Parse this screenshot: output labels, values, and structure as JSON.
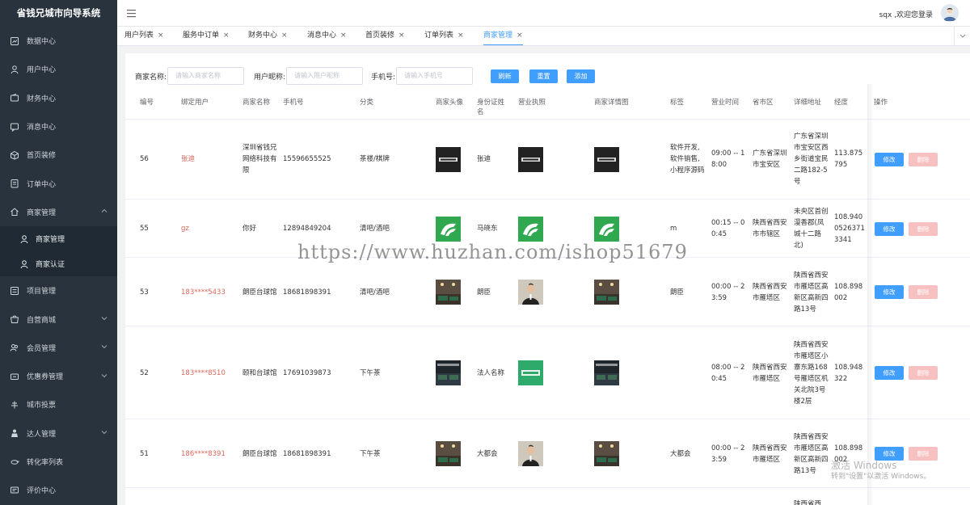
{
  "app_title": "省钱兄城市向导系统",
  "header": {
    "welcome": "sqx ,欢迎您登录"
  },
  "sidebar": {
    "items": [
      {
        "label": "数据中心",
        "icon": "dashboard-icon"
      },
      {
        "label": "用户中心",
        "icon": "user-icon"
      },
      {
        "label": "财务中心",
        "icon": "wallet-icon"
      },
      {
        "label": "消息中心",
        "icon": "message-icon"
      },
      {
        "label": "首页装修",
        "icon": "cube-icon"
      },
      {
        "label": "订单中心",
        "icon": "order-icon"
      },
      {
        "label": "商家管理",
        "icon": "home-icon"
      },
      {
        "label": "项目管理",
        "icon": "project-icon"
      },
      {
        "label": "自营商城",
        "icon": "shop-icon"
      },
      {
        "label": "会员管理",
        "icon": "member-icon"
      },
      {
        "label": "优惠券管理",
        "icon": "coupon-icon"
      },
      {
        "label": "城市投票",
        "icon": "vote-icon"
      },
      {
        "label": "达人管理",
        "icon": "expert-icon"
      },
      {
        "label": "转化率列表",
        "icon": "conversion-icon"
      },
      {
        "label": "评价中心",
        "icon": "review-icon"
      }
    ],
    "sub_items": [
      {
        "label": "商家管理"
      },
      {
        "label": "商家认证"
      }
    ]
  },
  "tabs": [
    {
      "label": "用户列表"
    },
    {
      "label": "服务中订单"
    },
    {
      "label": "财务中心"
    },
    {
      "label": "消息中心"
    },
    {
      "label": "首页装修"
    },
    {
      "label": "订单列表"
    },
    {
      "label": "商家管理"
    }
  ],
  "filters": {
    "merchant_name_label": "商家名称:",
    "merchant_name_placeholder": "请输入商家名称",
    "nickname_label": "用户昵称:",
    "nickname_placeholder": "请输入用户昵称",
    "phone_label": "手机号:",
    "phone_placeholder": "请输入手机号",
    "refresh": "刷新",
    "reset": "重置",
    "add": "添加"
  },
  "table": {
    "columns": [
      "编号",
      "绑定用户",
      "商家名称",
      "手机号",
      "分类",
      "商家头像",
      "身份证姓名",
      "营业执照",
      "商家详情图",
      "标签",
      "营业时间",
      "省市区",
      "详细地址",
      "经度",
      "操作"
    ],
    "edit_label": "修改",
    "delete_label": "删除",
    "rows": [
      {
        "id": "56",
        "user": "张迪",
        "name": "深圳省钱兄网络科技有限",
        "phone": "15596655525",
        "category": "茶楼/棋牌",
        "idname": "张迪",
        "tag": "软件开发,软件销售,小程序源码",
        "hours": "09:00 -- 18:00",
        "region": "广东省深圳市宝安区",
        "address": "广东省深圳市宝安区西乡街道宝民二路182-5号",
        "lng": "113.875795",
        "thumb": "brand"
      },
      {
        "id": "55",
        "user": "gz",
        "name": "你好",
        "phone": "12894849204",
        "category": "清吧/酒吧",
        "idname": "马晓东",
        "tag": "m",
        "hours": "00:15 -- 00:45",
        "region": "陕西省西安市市辖区",
        "address": "未央区首创漫香郡(凤城十二路北)",
        "lng": "108.94005263713341",
        "thumb": "green"
      },
      {
        "id": "53",
        "user": "183****5433",
        "name": "朗臣台球馆",
        "phone": "18681898391",
        "category": "清吧/酒吧",
        "idname": "朗臣",
        "tag": "朗臣",
        "hours": "00:00 -- 23:59",
        "region": "陕西省西安市雁塔区",
        "address": "陕西省西安市雁塔区高新区高新四路13号",
        "lng": "108.898002",
        "thumb": "photo"
      },
      {
        "id": "52",
        "user": "183****8510",
        "name": "颐和台球馆",
        "phone": "17691039873",
        "category": "下午茶",
        "idname": "法人名称",
        "tag": "",
        "hours": "08:00 -- 20:45",
        "region": "陕西省西安市雁塔区",
        "address": "陕西省西安市雁塔区小寨东路168号雁塔区机关北院3号楼2层",
        "lng": "108.948322",
        "thumb": "hall"
      },
      {
        "id": "51",
        "user": "186****8391",
        "name": "朗臣台球馆",
        "phone": "18681898391",
        "category": "下午茶",
        "idname": "大都会",
        "tag": "大都会",
        "hours": "00:00 -- 23:59",
        "region": "陕西省西安市雁塔区",
        "address": "陕西省西安市雁塔区高新区高新四路13号",
        "lng": "108.898002",
        "thumb": "photo"
      },
      {
        "id": "",
        "user": "",
        "name": "",
        "phone": "",
        "category": "",
        "idname": "",
        "tag": "",
        "hours": "",
        "region": "",
        "address": "陕西省西",
        "lng": "",
        "thumb": "none"
      }
    ]
  },
  "watermark": "https://www.huzhan.com/ishop51679",
  "activation": {
    "line1": "激活 Windows",
    "line2": "转到\"设置\"以激活 Windows。"
  }
}
